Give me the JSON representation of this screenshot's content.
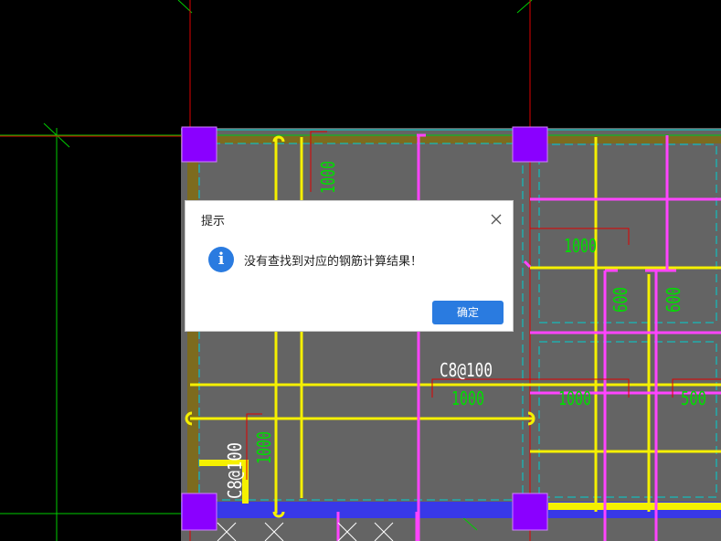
{
  "drawing": {
    "labels": [
      {
        "text": "1000",
        "color": "#00dd00"
      },
      {
        "text": "1000",
        "color": "#00dd00"
      },
      {
        "text": "600",
        "color": "#00dd00"
      },
      {
        "text": "600",
        "color": "#00dd00"
      },
      {
        "text": "C8@100",
        "color": "#ffffff"
      },
      {
        "text": "1000",
        "color": "#00dd00"
      },
      {
        "text": "1000",
        "color": "#00dd00"
      },
      {
        "text": "500",
        "color": "#00dd00"
      },
      {
        "text": "1000",
        "color": "#00dd00"
      },
      {
        "text": "C8@100",
        "color": "#ffffff"
      }
    ]
  },
  "dialog": {
    "title": "提示",
    "message": "没有查找到对应的钢筋计算结果！",
    "ok_label": "确定",
    "icon": "info-icon",
    "close_icon": "close-icon",
    "accent": "#2a7be0"
  }
}
